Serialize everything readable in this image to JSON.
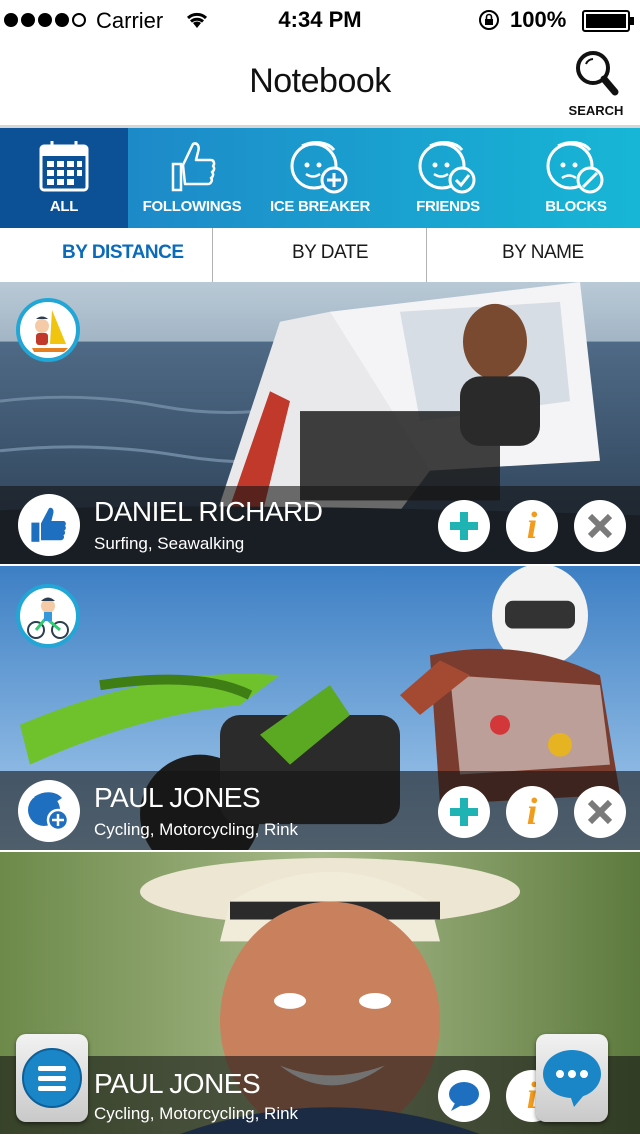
{
  "status_bar": {
    "carrier": "Carrier",
    "time": "4:34 PM",
    "battery": "100%",
    "battery_level": 1.0,
    "signal_bars": 4
  },
  "header": {
    "title": "Notebook",
    "search_label": "SEARCH"
  },
  "tabs": [
    {
      "label": "ALL",
      "icon": "calendar-icon",
      "active": true
    },
    {
      "label": "FOLLOWINGS",
      "icon": "thumbs-up-icon",
      "active": false
    },
    {
      "label": "ICE BREAKER",
      "icon": "face-add-icon",
      "active": false
    },
    {
      "label": "FRIENDS",
      "icon": "face-check-icon",
      "active": false
    },
    {
      "label": "BLOCKS",
      "icon": "face-block-icon",
      "active": false
    }
  ],
  "sort": {
    "by_distance": "BY DISTANCE",
    "by_date": "BY DATE",
    "by_name": "BY NAME",
    "selected": "by_distance"
  },
  "cards": [
    {
      "name": "DANIEL RICHARD",
      "activities": "Surfing, Seawalking",
      "avatar_icon": "windsurfer-avatar-icon",
      "lead_icon": "thumbs-up-icon"
    },
    {
      "name": "PAUL JONES",
      "activities": "Cycling, Motorcycling, Rink",
      "avatar_icon": "cyclist-avatar-icon",
      "lead_icon": "face-add-icon"
    },
    {
      "name": "PAUL JONES",
      "activities": "Cycling, Motorcycling, Rink",
      "lead_icon": "chat-bubble-icon"
    }
  ],
  "colors": {
    "brand_blue": "#0c5196",
    "tab_gradient_start": "#1f7ec5",
    "tab_gradient_end": "#17b6d6",
    "accent_teal": "#1fb3b3",
    "info_orange": "#f39b1b",
    "close_gray": "#7a7a7a"
  }
}
